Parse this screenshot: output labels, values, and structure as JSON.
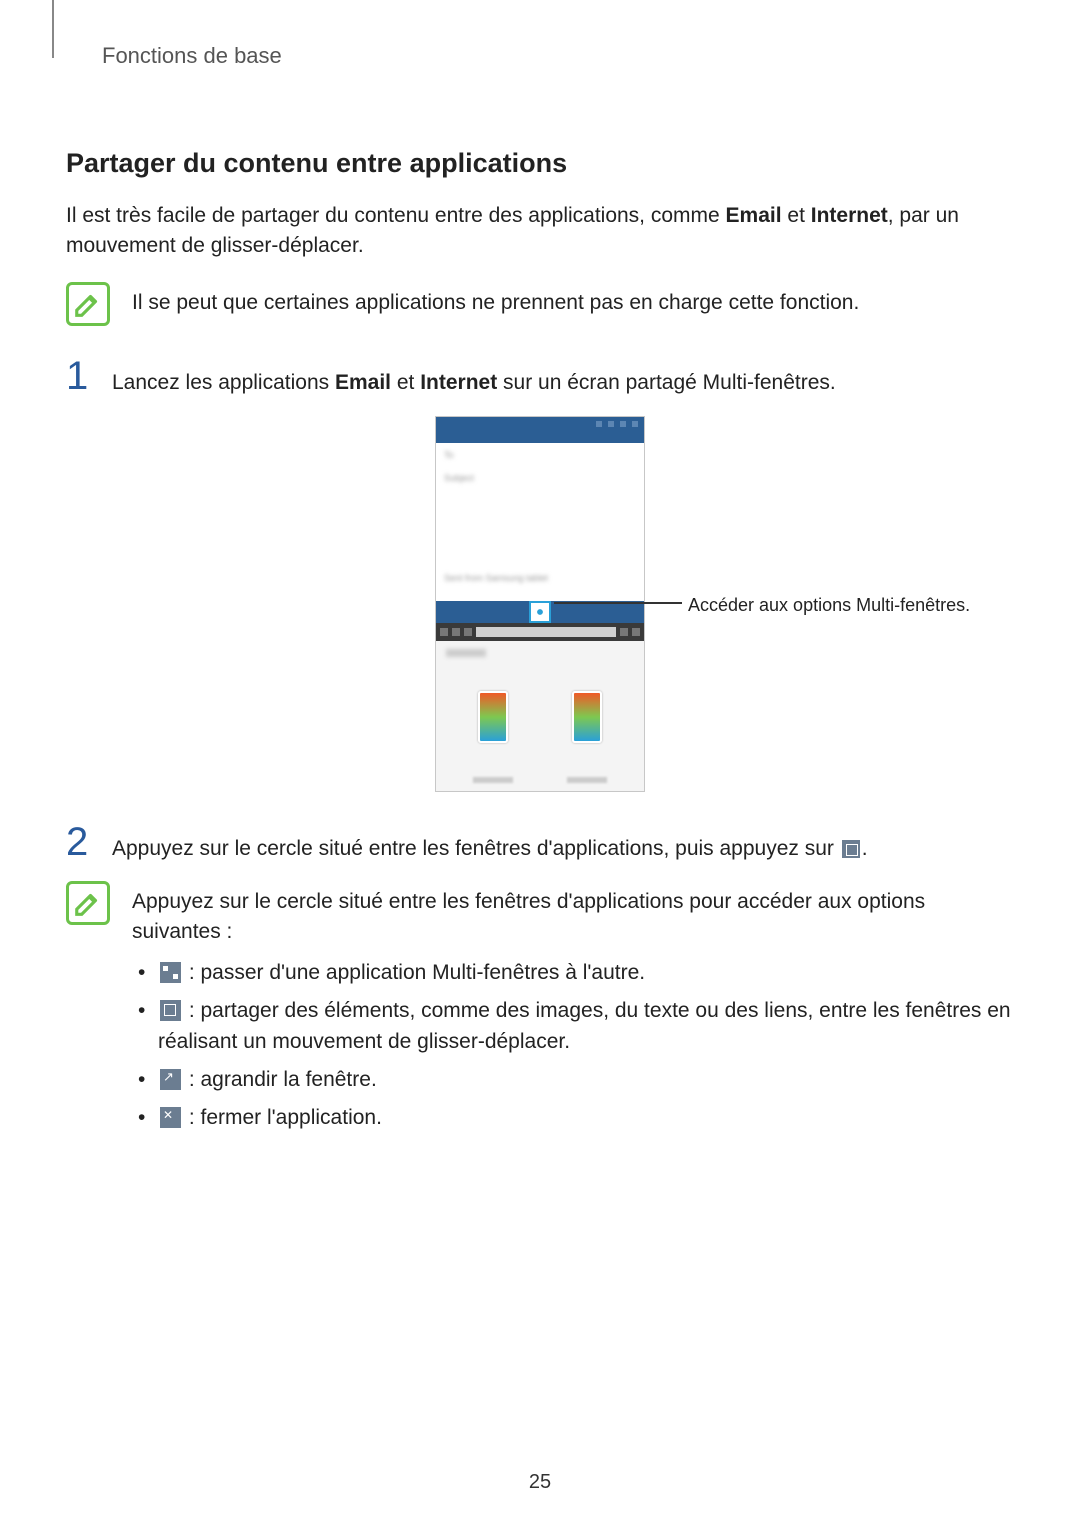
{
  "breadcrumb": "Fonctions de base",
  "heading": "Partager du contenu entre applications",
  "intro_1": "Il est très facile de partager du contenu entre des applications, comme ",
  "intro_bold1": "Email",
  "intro_mid": " et ",
  "intro_bold2": "Internet",
  "intro_2": ", par un mouvement de glisser-déplacer.",
  "note1": "Il se peut que certaines applications ne prennent pas en charge cette fonction.",
  "step1_num": "1",
  "step1_a": "Lancez les applications ",
  "step1_b1": "Email",
  "step1_mid": " et ",
  "step1_b2": "Internet",
  "step1_c": " sur un écran partagé Multi-fenêtres.",
  "callout": "Accéder aux options Multi-fenêtres.",
  "step2_num": "2",
  "step2_a": "Appuyez sur le cercle situé entre les fenêtres d'applications, puis appuyez sur ",
  "step2_b": ".",
  "note2_intro": "Appuyez sur le cercle situé entre les fenêtres d'applications pour accéder aux options suivantes :",
  "opt_swap": " : passer d'une application Multi-fenêtres à l'autre.",
  "opt_share": " : partager des éléments, comme des images, du texte ou des liens, entre les fenêtres en réalisant un mouvement de glisser-déplacer.",
  "opt_expand": " : agrandir la fenêtre.",
  "opt_close": " : fermer l'application.",
  "page_number": "25"
}
